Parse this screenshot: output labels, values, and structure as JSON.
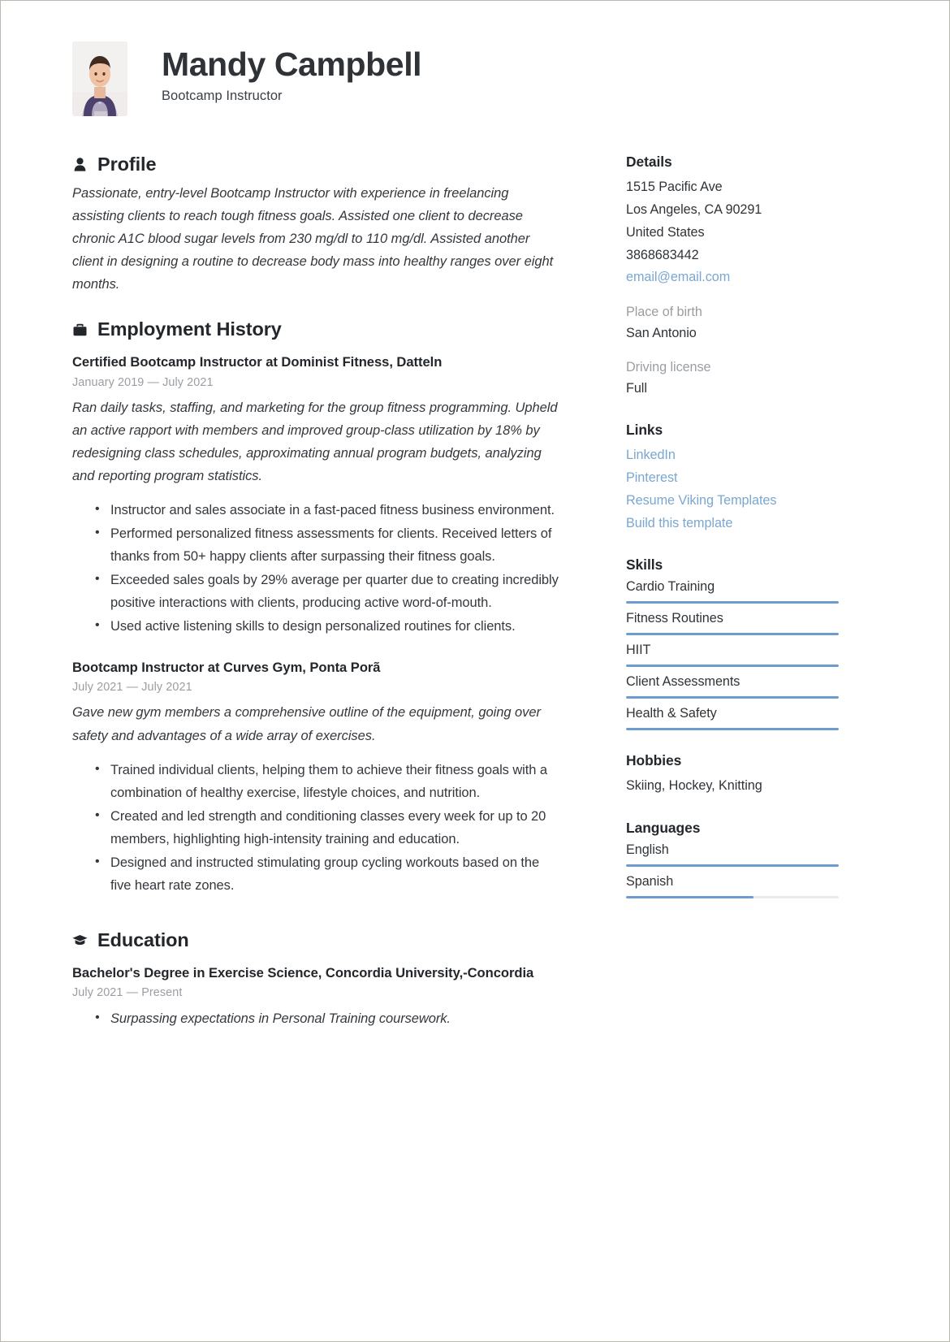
{
  "header": {
    "name": "Mandy Campbell",
    "job_title": "Bootcamp Instructor",
    "avatar_alt": "portrait-photo"
  },
  "profile": {
    "heading": "Profile",
    "icon": "person-icon",
    "text": "Passionate, entry-level Bootcamp Instructor with experience in freelancing assisting clients to reach tough fitness goals. Assisted one client to decrease chronic A1C blood sugar levels from 230 mg/dl to 110 mg/dl. Assisted another client in designing a routine to decrease body mass into healthy ranges over eight months."
  },
  "employment": {
    "heading": "Employment History",
    "icon": "briefcase-icon",
    "entries": [
      {
        "title": "Certified Bootcamp Instructor at Dominist Fitness, Datteln",
        "date": "January 2019 — July 2021",
        "description": "Ran daily tasks, staffing, and marketing for the group fitness programming. Upheld an active rapport with members and improved group-class utilization by 18% by redesigning class schedules, approximating annual program budgets, analyzing and reporting program statistics.",
        "bullets": [
          "Instructor and sales associate in a fast-paced fitness business environment.",
          "Performed personalized fitness assessments for clients. Received letters of thanks from 50+ happy clients after surpassing their fitness goals.",
          "Exceeded sales goals by 29% average per quarter due to creating incredibly positive interactions with clients, producing active word-of-mouth.",
          "Used active listening skills to design personalized routines for clients."
        ]
      },
      {
        "title": "Bootcamp Instructor  at Curves Gym, Ponta Porã",
        "date": "July 2021 — July 2021",
        "description": "Gave new gym members a comprehensive outline of the equipment, going over safety and advantages of a wide array of exercises.",
        "bullets": [
          "Trained individual clients, helping them to achieve their fitness goals with a combination of healthy exercise, lifestyle choices, and nutrition.",
          "Created and led strength and conditioning classes every week for up to 20 members, highlighting high-intensity training and education.",
          "Designed and instructed stimulating group cycling workouts based on the five heart rate zones."
        ]
      }
    ]
  },
  "education": {
    "heading": "Education",
    "icon": "graduation-cap-icon",
    "entries": [
      {
        "title": "Bachelor's Degree in Exercise Science, Concordia University,-Concordia",
        "date": "July 2021 — Present",
        "bullets": [
          "Surpassing expectations in Personal Training coursework."
        ]
      }
    ]
  },
  "details": {
    "heading": "Details",
    "address_line1": "1515 Pacific Ave",
    "address_line2": "Los Angeles, CA 90291",
    "country": "United States",
    "phone": "3868683442",
    "email": "email@email.com",
    "place_of_birth_label": "Place of birth",
    "place_of_birth": "San Antonio",
    "driving_license_label": "Driving license",
    "driving_license": "Full"
  },
  "links": {
    "heading": "Links",
    "items": [
      {
        "label": "LinkedIn"
      },
      {
        "label": "Pinterest"
      },
      {
        "label": "Resume Viking Templates"
      },
      {
        "label": "Build this template"
      }
    ]
  },
  "skills": {
    "heading": "Skills",
    "items": [
      {
        "name": "Cardio Training",
        "level": 100
      },
      {
        "name": "Fitness Routines",
        "level": 100
      },
      {
        "name": "HIIT",
        "level": 100
      },
      {
        "name": "Client Assessments",
        "level": 100
      },
      {
        "name": "Health & Safety",
        "level": 100
      }
    ]
  },
  "hobbies": {
    "heading": "Hobbies",
    "text": "Skiing, Hockey, Knitting"
  },
  "languages": {
    "heading": "Languages",
    "items": [
      {
        "name": "English",
        "level": 100
      },
      {
        "name": "Spanish",
        "level": 60
      }
    ]
  },
  "colors": {
    "accent": "#6c9bd0",
    "link": "#7aa7d0",
    "muted": "#9a9ea3",
    "text": "#2f3337",
    "track": "#e8e9ea"
  }
}
